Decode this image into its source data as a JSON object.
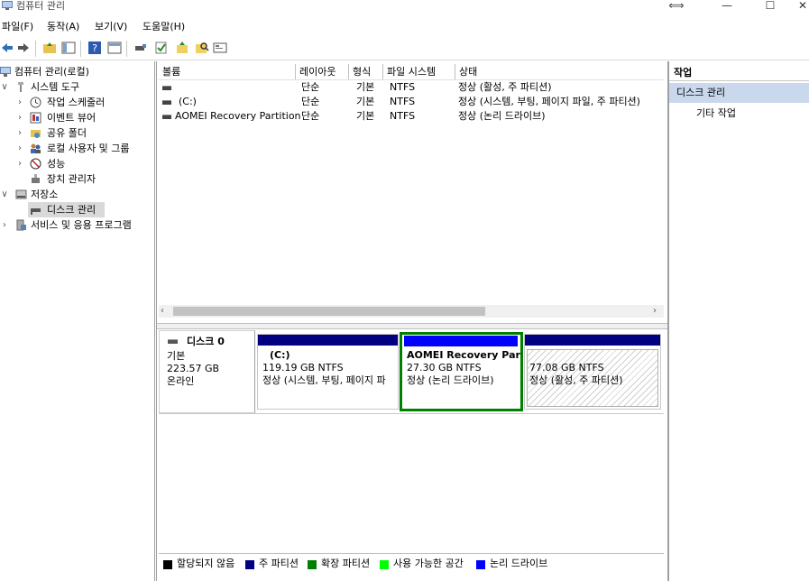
{
  "window": {
    "title": "컴퓨터 관리",
    "controls": [
      "—",
      "☐",
      "✕"
    ]
  },
  "menu": [
    "파일(F)",
    "동작(A)",
    "보기(V)",
    "도움말(H)"
  ],
  "tree": {
    "root": "컴퓨터 관리(로컬)",
    "system_tools": "시스템 도구",
    "task_scheduler": "작업 스케줄러",
    "event_viewer": "이벤트 뷰어",
    "shared_folders": "공유 폴더",
    "local_users": "로컬 사용자 및 그룹",
    "performance": "성능",
    "device_manager": "장치 관리자",
    "storage": "저장소",
    "disk_management": "디스크 관리",
    "services_apps": "서비스 및 응용 프로그램"
  },
  "volume_list": {
    "columns": [
      "볼륨",
      "레이아웃",
      "형식",
      "파일 시스템",
      "상태"
    ],
    "rows": [
      {
        "volume": "",
        "layout": "단순",
        "type": "기본",
        "fs": "NTFS",
        "status": "정상 (활성, 주 파티션)"
      },
      {
        "volume": "(C:)",
        "layout": "단순",
        "type": "기본",
        "fs": "NTFS",
        "status": "정상 (시스템, 부팅, 페이지 파일, 주 파티션)"
      },
      {
        "volume": "AOMEI Recovery Partition",
        "layout": "단순",
        "type": "기본",
        "fs": "NTFS",
        "status": "정상 (논리 드라이브)"
      }
    ]
  },
  "disk": {
    "name": "디스크 0",
    "type": "기본",
    "size": "223.57 GB",
    "state": "온라인",
    "partitions": [
      {
        "title": "(C:)",
        "size": "119.19 GB NTFS",
        "status": "정상 (시스템, 부팅, 페이지 파",
        "bar_color": "#000080"
      },
      {
        "title": "AOMEI Recovery Part",
        "size": "27.30 GB NTFS",
        "status": "정상 (논리 드라이브)",
        "bar_color": "#0000ff"
      },
      {
        "title": "",
        "size": "77.08 GB NTFS",
        "status": "정상 (활성, 주 파티션)",
        "bar_color": "#000080"
      }
    ]
  },
  "legend": [
    {
      "label": "할당되지 않음",
      "color": "#000000"
    },
    {
      "label": "주 파티션",
      "color": "#000080"
    },
    {
      "label": "확장 파티션",
      "color": "#008000"
    },
    {
      "label": "사용 가능한 공간",
      "color": "#00ff00"
    },
    {
      "label": "논리 드라이브",
      "color": "#0000ff"
    }
  ],
  "actions": {
    "title": "작업",
    "group": "디스크 관리",
    "item": "기타 작업"
  },
  "colors": {
    "selection_border": "#008000",
    "action_group_bg": "#c9d8ec"
  }
}
